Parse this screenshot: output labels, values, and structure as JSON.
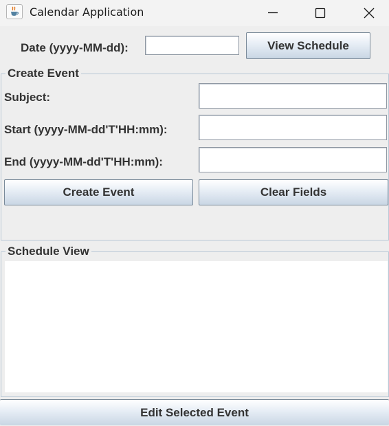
{
  "window": {
    "title": "Calendar Application",
    "icon": "java-cup-icon",
    "controls": [
      "minimize-icon",
      "maximize-icon",
      "close-icon"
    ]
  },
  "date_row": {
    "label": "Date (yyyy-MM-dd):",
    "value": "",
    "button": "View Schedule"
  },
  "create_event": {
    "title": "Create Event",
    "subject_label": "Subject:",
    "subject_value": "",
    "start_label": "Start (yyyy-MM-dd'T'HH:mm):",
    "start_value": "",
    "end_label": "End (yyyy-MM-dd'T'HH:mm):",
    "end_value": "",
    "create_button": "Create Event",
    "clear_button": "Clear Fields"
  },
  "schedule_view": {
    "title": "Schedule View",
    "content": ""
  },
  "footer": {
    "edit_button": "Edit Selected Event"
  }
}
